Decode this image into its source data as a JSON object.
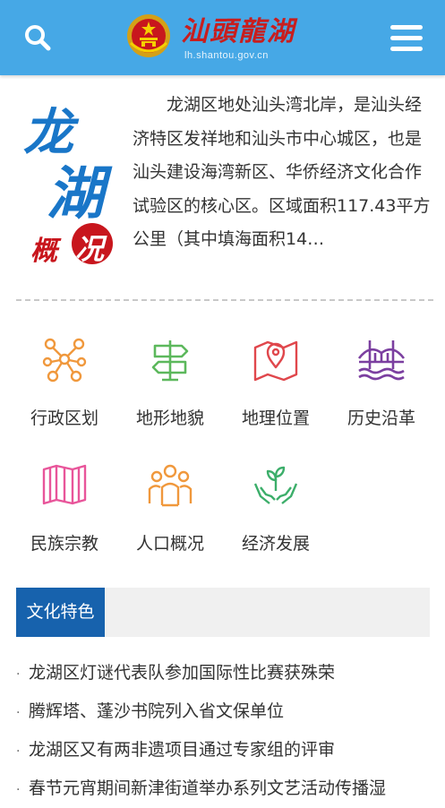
{
  "header": {
    "logo_text": "汕頭龍湖",
    "logo_domain": "lh.shantou.gov.cn",
    "background_color": "#46a8e6"
  },
  "intro": {
    "graphic_title_1": "龙",
    "graphic_title_2": "湖",
    "graphic_subtitle_1": "概",
    "graphic_subtitle_2": "况",
    "text": "龙湖区地处汕头湾北岸，是汕头经济特区发祥地和汕头市中心城区，也是汕头建设海湾新区、华侨经济文化合作试验区的核心区。区域面积117.43平方公里（其中填海面积14…"
  },
  "categories": [
    {
      "label": "行政区划",
      "icon": "network-icon",
      "color": "#f0983c"
    },
    {
      "label": "地形地貌",
      "icon": "signpost-icon",
      "color": "#5cb85c"
    },
    {
      "label": "地理位置",
      "icon": "map-pin-icon",
      "color": "#e0474c"
    },
    {
      "label": "历史沿革",
      "icon": "bridge-icon",
      "color": "#7b3fa0"
    },
    {
      "label": "民族宗教",
      "icon": "folded-map-icon",
      "color": "#e8559a"
    },
    {
      "label": "人口概况",
      "icon": "people-icon",
      "color": "#f0983c"
    },
    {
      "label": "经济发展",
      "icon": "hands-plant-icon",
      "color": "#3cae6a"
    }
  ],
  "culture": {
    "tab_label": "文化特色",
    "accent_color": "#1762ad",
    "news": [
      "龙湖区灯谜代表队参加国际性比赛获殊荣",
      "腾辉塔、蓬沙书院列入省文保单位",
      "龙湖区又有两非遗项目通过专家组的评审",
      "春节元宵期间新津街道举办系列文艺活动传播湿"
    ]
  }
}
